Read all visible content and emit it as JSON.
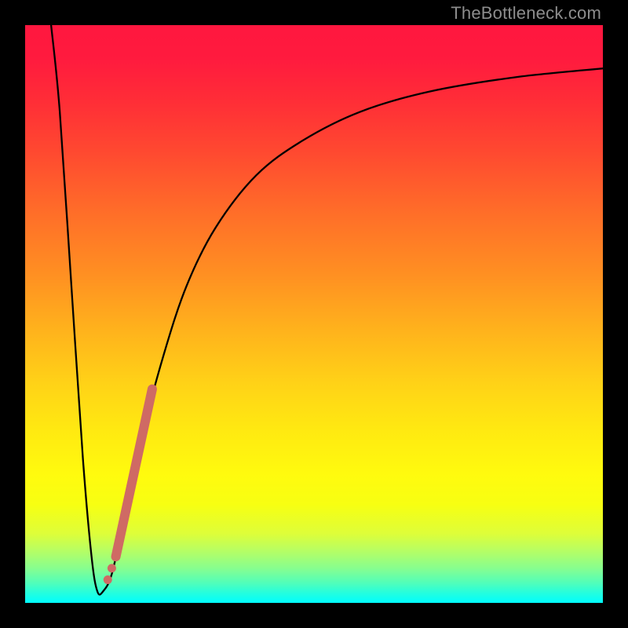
{
  "watermark": "TheBottleneck.com",
  "colors": {
    "frame": "#000000",
    "curve": "#000000",
    "marker": "#cf6a64",
    "gradient_top": "#ff173f",
    "gradient_bottom": "#00fefe"
  },
  "chart_data": {
    "type": "line",
    "title": "",
    "xlabel": "",
    "ylabel": "",
    "xlim": [
      0,
      100
    ],
    "ylim": [
      0,
      100
    ],
    "notes": "Background vertical gradient from red (top, high bottleneck) through orange/yellow to green/cyan (bottom, low bottleneck). Black curve: steep descending line from top-left down to a minimum near x≈12, then rising asymptotically toward the top-right. y represents approximate bottleneck percentage (0 = best, 100 = worst).",
    "curve_points": [
      {
        "x": 4.5,
        "y": 100
      },
      {
        "x": 6.0,
        "y": 85
      },
      {
        "x": 8.0,
        "y": 55
      },
      {
        "x": 10.0,
        "y": 25
      },
      {
        "x": 11.5,
        "y": 8
      },
      {
        "x": 12.5,
        "y": 2
      },
      {
        "x": 13.5,
        "y": 2
      },
      {
        "x": 15.0,
        "y": 5
      },
      {
        "x": 17.0,
        "y": 14
      },
      {
        "x": 20.0,
        "y": 28
      },
      {
        "x": 24.0,
        "y": 43
      },
      {
        "x": 28.0,
        "y": 55
      },
      {
        "x": 33.0,
        "y": 65
      },
      {
        "x": 40.0,
        "y": 74
      },
      {
        "x": 48.0,
        "y": 80
      },
      {
        "x": 58.0,
        "y": 85
      },
      {
        "x": 70.0,
        "y": 88.5
      },
      {
        "x": 85.0,
        "y": 91
      },
      {
        "x": 100.0,
        "y": 92.5
      }
    ],
    "marker_segment": {
      "description": "Thick salmon segment overlaid on ascending branch",
      "points": [
        {
          "x": 15.7,
          "y": 8
        },
        {
          "x": 22.0,
          "y": 37
        }
      ]
    },
    "marker_dots": [
      {
        "x": 14.3,
        "y": 4
      },
      {
        "x": 15.0,
        "y": 6
      }
    ]
  }
}
